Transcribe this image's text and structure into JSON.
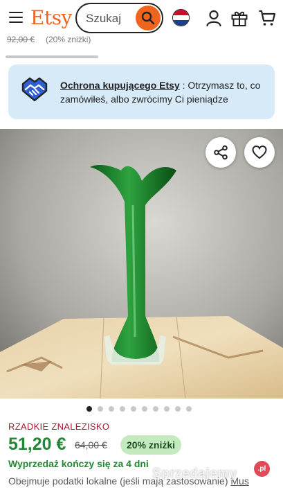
{
  "header": {
    "logo": "Etsy",
    "search_placeholder": "Szukaj",
    "icons": [
      "menu-icon",
      "search-icon",
      "flag-netherlands-icon",
      "account-icon",
      "gift-icon",
      "cart-icon"
    ],
    "accent_color": "#f1641e"
  },
  "previous_item": {
    "price": "92,00 €",
    "discount": "(20% zniżki)"
  },
  "protection_banner": {
    "link_text": "Ochrona kupującego Etsy",
    "separator": " : ",
    "text": "Otrzymasz to, co zamówiłeś, albo zwrócimy Ci pieniądze",
    "background": "#d6eaf8"
  },
  "gallery": {
    "image_count": 10,
    "active_index": 0,
    "image_subject": "green glass vase on marble base"
  },
  "listing": {
    "tag": "RZADKIE ZNALEZISKO",
    "price": "51,20 €",
    "original_price": "64,00 €",
    "discount_badge": "20% zniżki",
    "sale_notice": "Wyprzedaż kończy się za 4 dni",
    "tax_text": "Obejmuje podatki lokalne (jeśli mają zastosowanie)",
    "tax_link": "Mus"
  },
  "watermark": {
    "text": "Sprzedajemy",
    "suffix": ".pl"
  }
}
